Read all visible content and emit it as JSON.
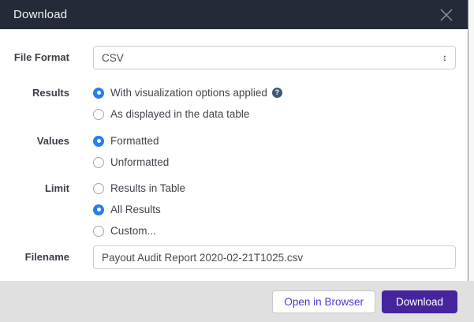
{
  "modal": {
    "title": "Download"
  },
  "icons": {
    "help_glyph": "?",
    "select_updown_glyph": "↕"
  },
  "form": {
    "file_format": {
      "label": "File Format",
      "value": "CSV"
    },
    "results": {
      "label": "Results",
      "options": [
        {
          "label": "With visualization options applied",
          "selected": true,
          "has_help": true
        },
        {
          "label": "As displayed in the data table",
          "selected": false
        }
      ]
    },
    "values": {
      "label": "Values",
      "options": [
        {
          "label": "Formatted",
          "selected": true
        },
        {
          "label": "Unformatted",
          "selected": false
        }
      ]
    },
    "limit": {
      "label": "Limit",
      "options": [
        {
          "label": "Results in Table",
          "selected": false
        },
        {
          "label": "All Results",
          "selected": true
        },
        {
          "label": "Custom...",
          "selected": false
        }
      ]
    },
    "filename": {
      "label": "Filename",
      "value": "Payout Audit Report 2020-02-21T1025.csv"
    }
  },
  "footer": {
    "open_in_browser_label": "Open in Browser",
    "download_label": "Download"
  },
  "colors": {
    "header_bg": "#242a37",
    "radio_selected": "#2b7de9",
    "help_icon_bg": "#3f5878",
    "primary_button_bg": "#45249e",
    "secondary_button_text": "#5632d2",
    "footer_bg": "#e0e0e0"
  }
}
